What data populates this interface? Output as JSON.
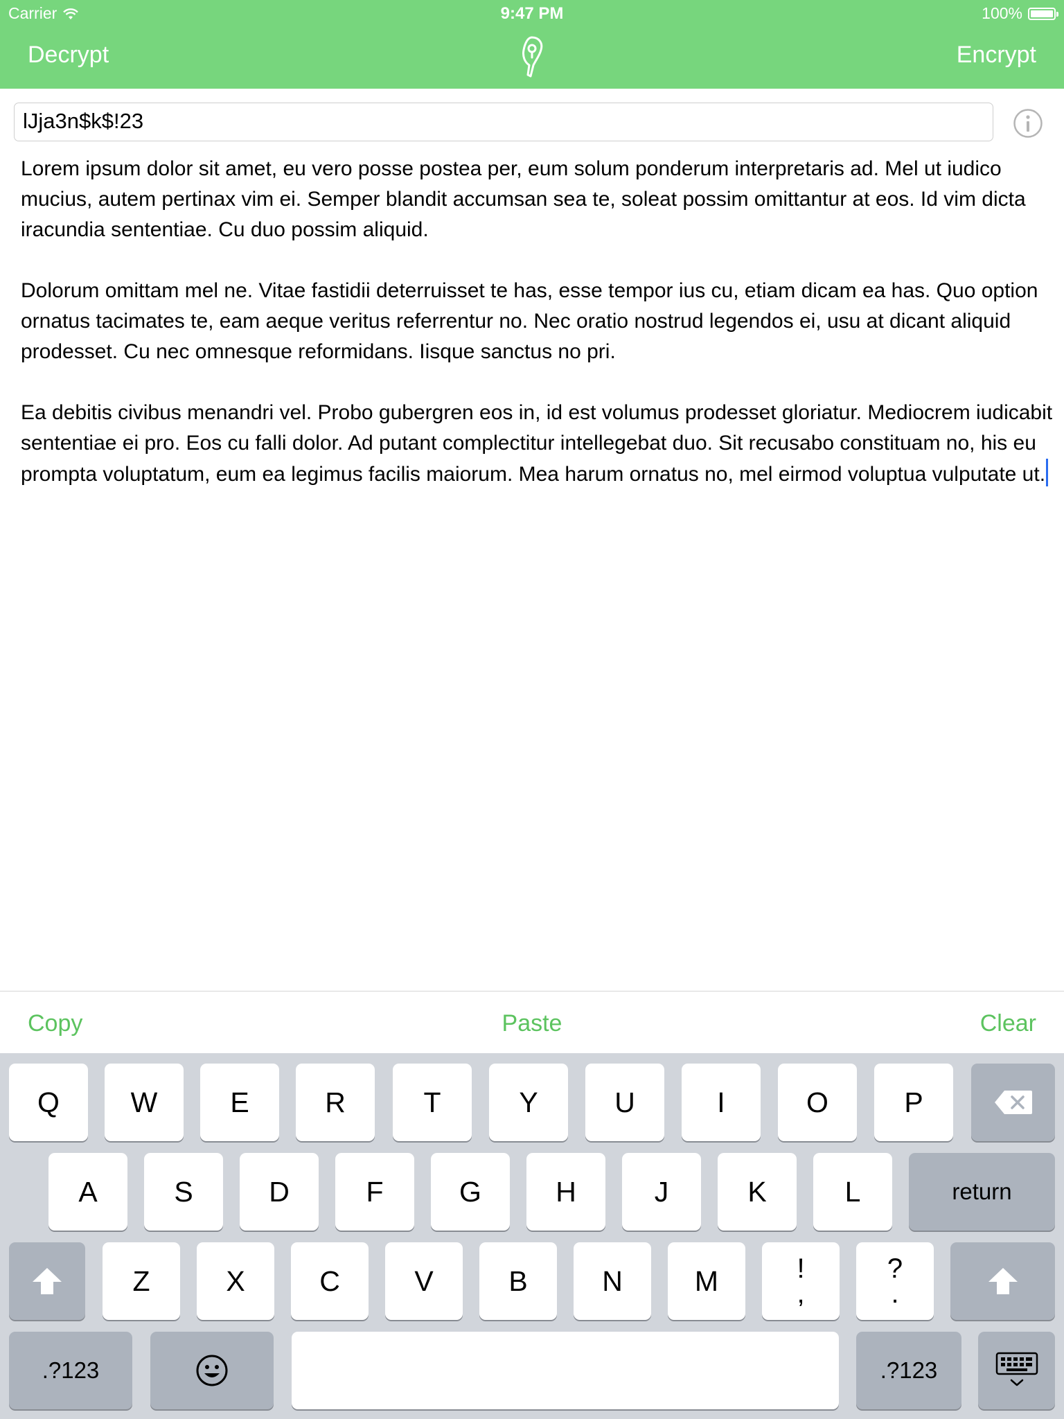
{
  "status": {
    "carrier": "Carrier",
    "time": "9:47 PM",
    "battery": "100%",
    "battery_level": 1.0
  },
  "nav": {
    "left_label": "Decrypt",
    "right_label": "Encrypt",
    "logo_icon": "feather-lock-icon"
  },
  "key_field": {
    "value": "lJja3n$k$!23"
  },
  "body": {
    "paragraphs": [
      "Lorem ipsum dolor sit amet, eu vero posse postea per, eum solum ponderum interpretaris ad. Mel ut iudico mucius, autem pertinax vim ei. Semper blandit accumsan sea te, soleat possim omittantur at eos. Id vim dicta iracundia sententiae. Cu duo possim aliquid.",
      "Dolorum omittam mel ne. Vitae fastidii deterruisset te has, esse tempor ius cu, etiam dicam ea has. Quo option ornatus tacimates te, eam aeque veritus referrentur no. Nec oratio nostrud legendos ei, usu at dicant aliquid prodesset. Cu nec omnesque reformidans. Iisque sanctus no pri.",
      "Ea debitis civibus menandri vel. Probo gubergren eos in, id est volumus prodesset gloriatur. Mediocrem iudicabit sententiae ei pro. Eos cu falli dolor. Ad putant complectitur intellegebat duo. Sit recusabo constituam no, his eu prompta voluptatum, eum ea legimus facilis maiorum. Mea harum ornatus no, mel eirmod voluptua vulputate ut."
    ]
  },
  "accessory": {
    "copy": "Copy",
    "paste": "Paste",
    "clear": "Clear"
  },
  "keyboard": {
    "row1": [
      "Q",
      "W",
      "E",
      "R",
      "T",
      "Y",
      "U",
      "I",
      "O",
      "P"
    ],
    "row2": [
      "A",
      "S",
      "D",
      "F",
      "G",
      "H",
      "J",
      "K",
      "L"
    ],
    "row3": [
      "Z",
      "X",
      "C",
      "V",
      "B",
      "N",
      "M"
    ],
    "return": "return",
    "num_left": ".?123",
    "num_right": ".?123",
    "punct1": [
      "!",
      ","
    ],
    "punct2": [
      "?",
      "."
    ],
    "icons": {
      "delete": "backspace-icon",
      "shift": "shift-icon",
      "emoji": "emoji-icon",
      "dismiss": "keyboard-dismiss-icon"
    }
  },
  "colors": {
    "accent": "#77d67d",
    "accent_text": "#5cc35f",
    "caret": "#2a6cf0",
    "keyboard_bg": "#d1d5db",
    "dark_key": "#acb3bd"
  }
}
